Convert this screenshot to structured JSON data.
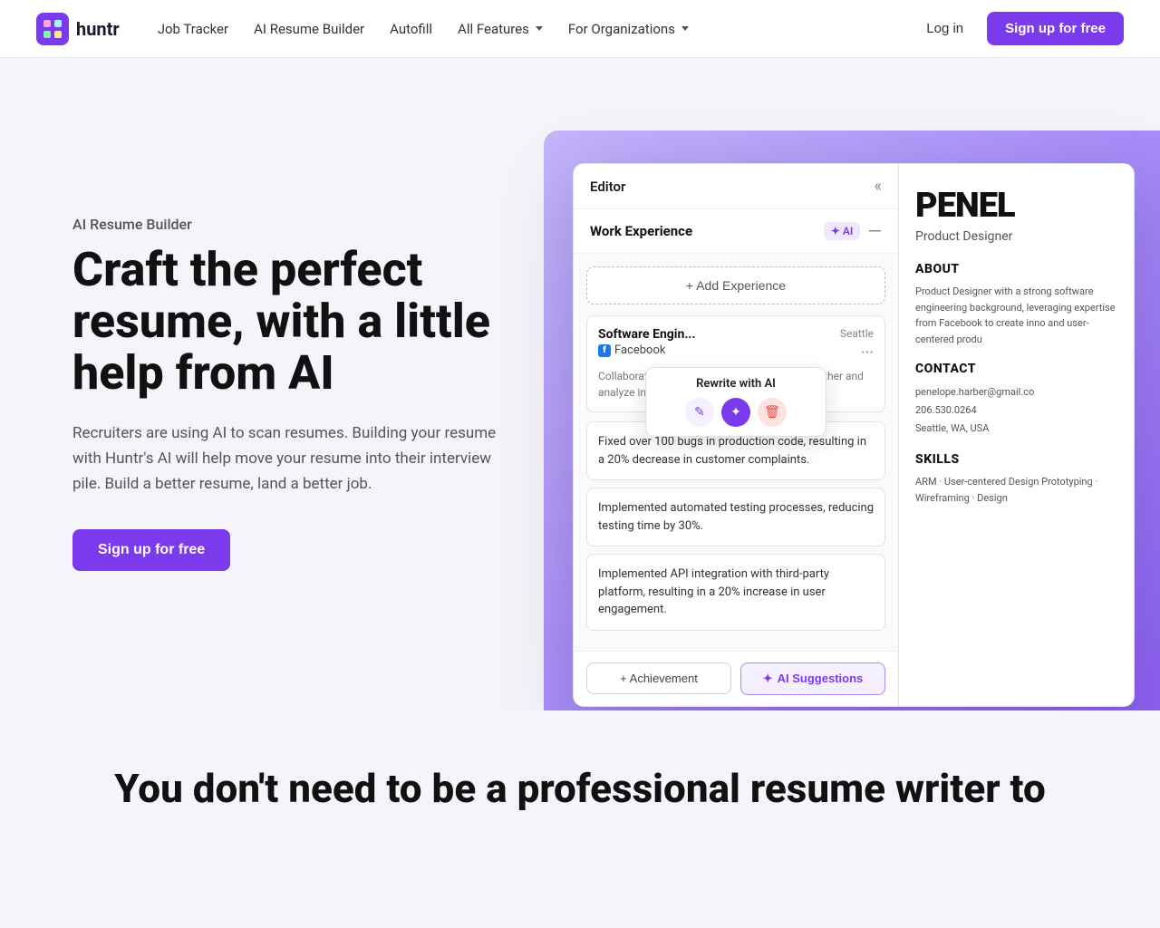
{
  "nav": {
    "logo_text": "huntr",
    "links": [
      {
        "label": "Job Tracker",
        "id": "job-tracker"
      },
      {
        "label": "AI Resume Builder",
        "id": "ai-resume-builder"
      },
      {
        "label": "Autofill",
        "id": "autofill"
      },
      {
        "label": "All Features",
        "id": "all-features",
        "has_chevron": true
      },
      {
        "label": "For Organizations",
        "id": "for-organizations",
        "has_chevron": true
      }
    ],
    "login_label": "Log in",
    "signup_label": "Sign up for free"
  },
  "hero": {
    "subtitle": "AI Resume Builder",
    "title": "Craft the perfect resume, with a little help from AI",
    "description": "Recruiters are using AI to scan resumes. Building your resume with Huntr's AI will help move your resume into their interview pile. Build a better resume, land a better job.",
    "cta_label": "Sign up for free"
  },
  "editor": {
    "title": "Editor",
    "collapse_icon": "«",
    "section_title": "Work Experience",
    "ai_badge": "✦ AI",
    "minus_icon": "—",
    "add_experience_label": "+ Add Experience",
    "job": {
      "title": "Software Engin...",
      "company": "Facebook",
      "location": "Seattle",
      "description": "Collaborated with cross-functional teams to gather and analyze industry trends",
      "more_icon": "···"
    },
    "rewrite_popup": {
      "label": "Rewrite with AI",
      "edit_icon": "✎",
      "ai_icon": "✦",
      "delete_icon": "🗑"
    },
    "achievements": [
      {
        "text": "Fixed over 100 bugs in production code, resulting in a 20% decrease in customer complaints."
      },
      {
        "text": "Implemented automated testing processes, reducing testing time by 30%."
      },
      {
        "text": "Implemented API integration with third-party platform, resulting in a 20% increase in user engagement."
      }
    ],
    "footer": {
      "achievement_label": "+ Achievement",
      "ai_suggestions_label": "AI Suggestions",
      "ai_icon": "✦"
    }
  },
  "resume": {
    "name": "PENEL",
    "role": "Product Designer",
    "about_title": "About",
    "about_text": "Product Designer with a strong software engineering background, leveraging expertise from Facebook to create inno and user-centered produ",
    "contact_title": "Contact",
    "contact_email": "penelope.harber@gmail.co",
    "contact_phone": "206.530.0264",
    "contact_address": "Seattle, WA, USA",
    "skills_title": "Skills",
    "skills_text": "ARM · User-centered Design Prototyping · Wireframing · Design"
  },
  "bottom": {
    "title": "You don't need to be a professional resume writer to"
  },
  "colors": {
    "primary": "#7c3aed",
    "primary_light": "#ede9fe",
    "bg": "#f5f4fa"
  }
}
